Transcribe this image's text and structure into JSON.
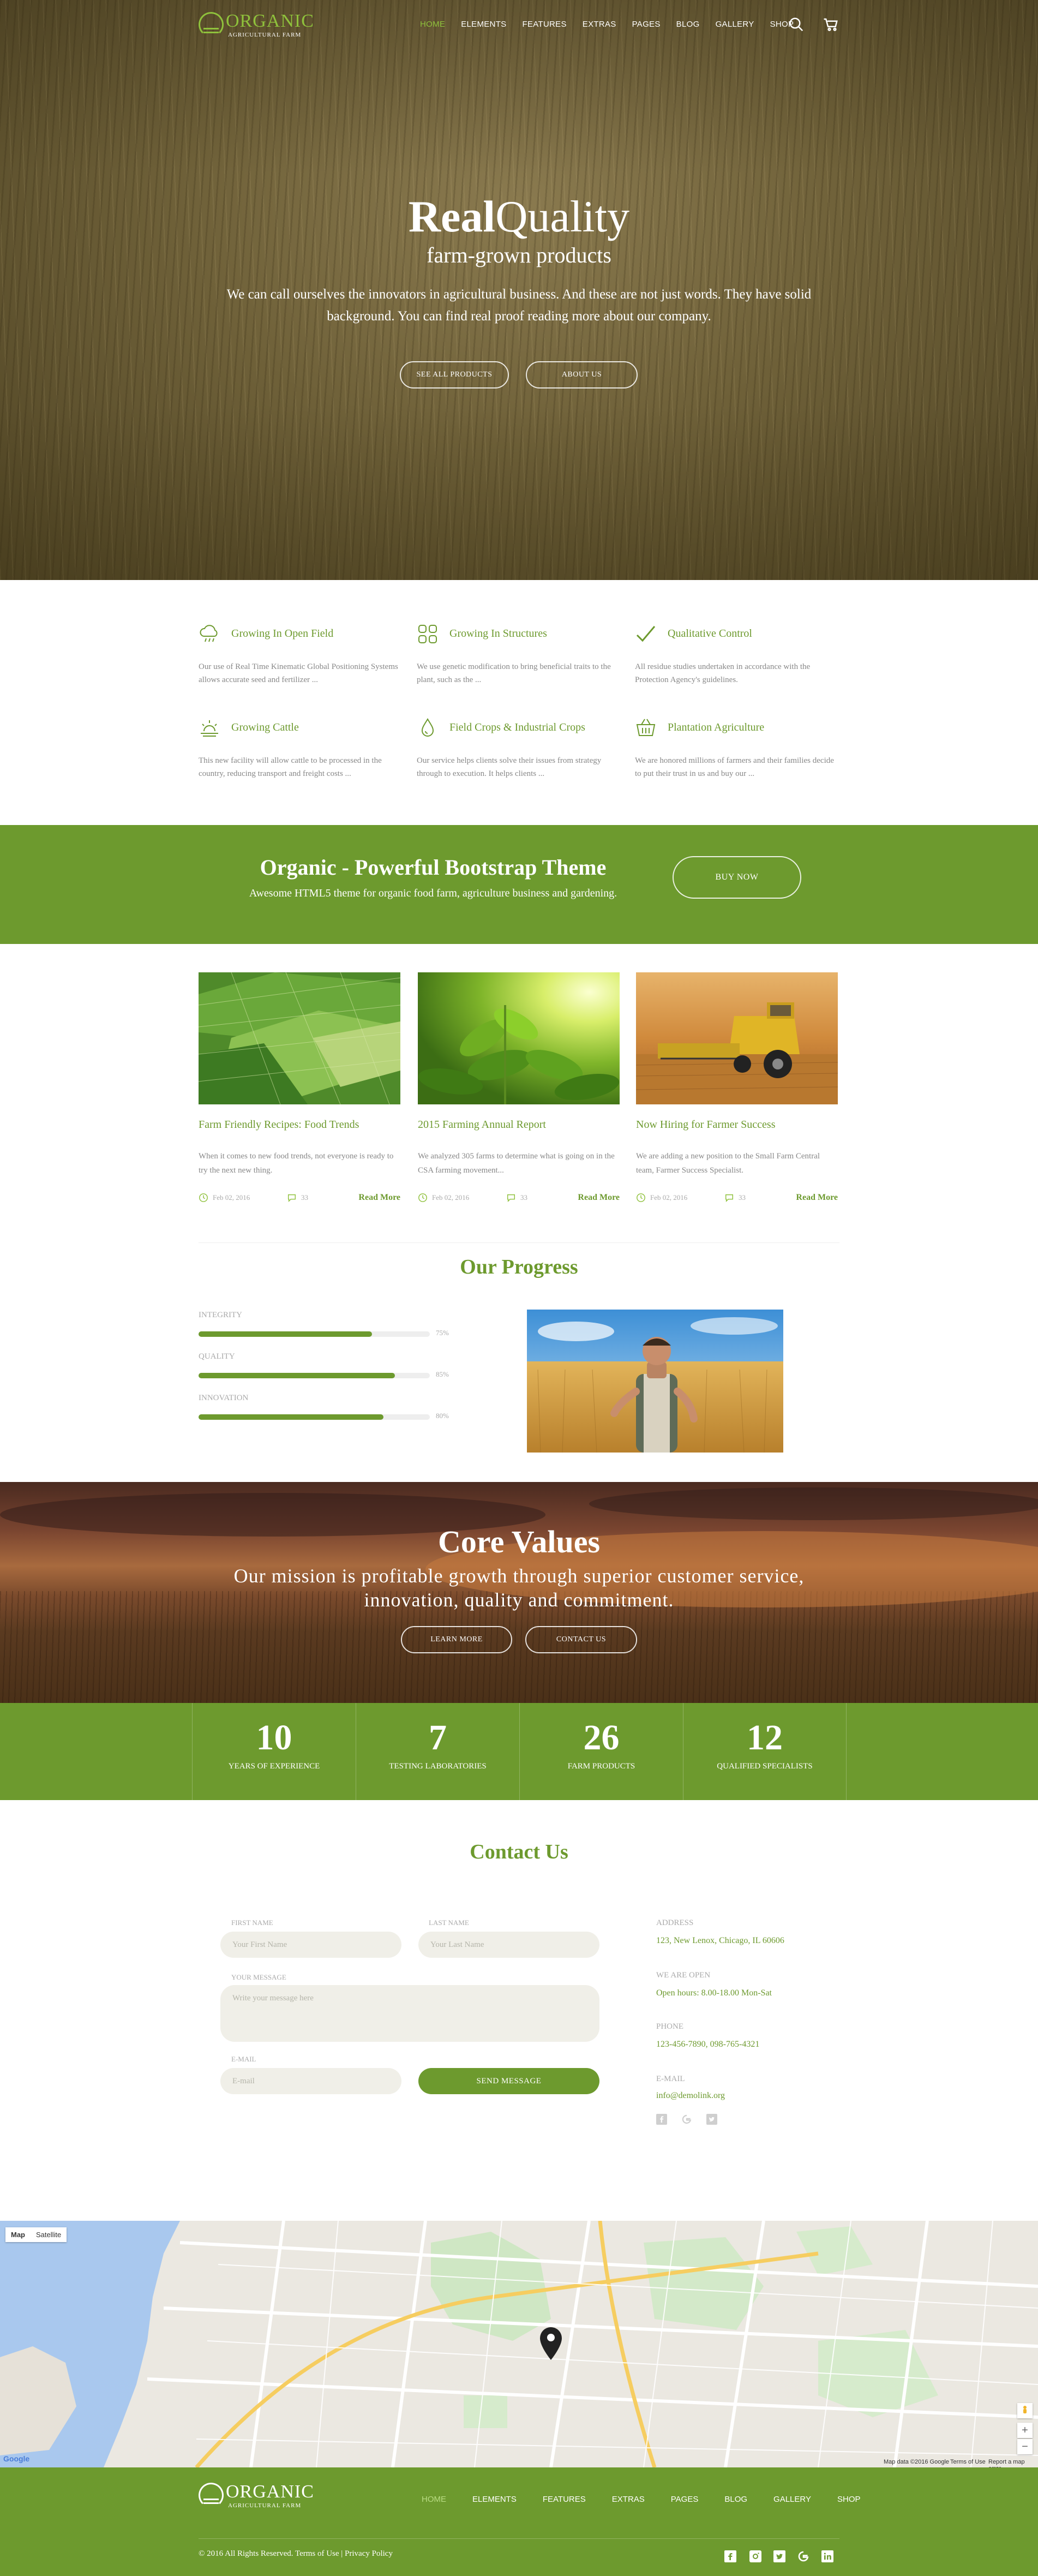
{
  "brand": {
    "name": "ORGANIC",
    "tagline": "Agricultural Farm"
  },
  "nav": [
    "HOME",
    "ELEMENTS",
    "FEATURES",
    "EXTRAS",
    "PAGES",
    "BLOG",
    "GALLERY",
    "SHOP"
  ],
  "hero": {
    "title_bold": "Real",
    "title_light": "Quality",
    "subtitle": "farm-grown products",
    "description": "We can call ourselves the innovators in agricultural business. And these are not just words. They have solid background. You can find real proof reading more about our company.",
    "btn_products": "SEE ALL PRODUCTS",
    "btn_about": "ABOUT US"
  },
  "features": [
    {
      "icon": "cloud-rain-icon",
      "title": "Growing In Open Field",
      "text": "Our use of Real Time Kinematic Global Positioning Systems allows accurate seed and fertilizer ..."
    },
    {
      "icon": "grid-icon",
      "title": "Growing In Structures",
      "text": "We use genetic modification to bring beneficial traits to the plant, such as the ..."
    },
    {
      "icon": "check-icon",
      "title": "Qualitative Control",
      "text": "All residue studies undertaken in accordance with the Protection Agency's guidelines."
    },
    {
      "icon": "sunrise-icon",
      "title": "Growing Cattle",
      "text": "This new facility will allow cattle to be processed in the country, reducing transport and freight costs ..."
    },
    {
      "icon": "drop-icon",
      "title": "Field Crops & Industrial Crops",
      "text": "Our service helps clients solve their issues from strategy through to execution. It helps clients ..."
    },
    {
      "icon": "basket-icon",
      "title": "Plantation Agriculture",
      "text": "We are honored millions of farmers and their families decide to put their trust in us and buy our ..."
    }
  ],
  "banner": {
    "title": "Organic - Powerful Bootstrap Theme",
    "subtitle": "Awesome HTML5 theme for organic food farm, agriculture business and gardening.",
    "button": "BUY NOW"
  },
  "posts": [
    {
      "title": "Farm Friendly Recipes: Food Trends",
      "text": "When it comes to new food trends, not everyone is ready to try the next new thing.",
      "date": "Feb 02, 2016",
      "comments": "33",
      "more": "Read More"
    },
    {
      "title": "2015 Farming Annual Report",
      "text": "We analyzed 305 farms to determine what is going on in the CSA farming movement...",
      "date": "Feb 02, 2016",
      "comments": "33",
      "more": "Read More"
    },
    {
      "title": "Now Hiring for Farmer Success",
      "text": "We are adding a new position to the Small Farm Central team, Farmer Success Specialist.",
      "date": "Feb 02, 2016",
      "comments": "33",
      "more": "Read More"
    }
  ],
  "progress": {
    "title": "Our Progress",
    "bars": [
      {
        "label": "INTEGRITY",
        "value": 75,
        "pct": "75%"
      },
      {
        "label": "QUALITY",
        "value": 85,
        "pct": "85%"
      },
      {
        "label": "INNOVATION",
        "value": 80,
        "pct": "80%"
      }
    ]
  },
  "core": {
    "title_bold": "Core",
    "title_light": "Values",
    "subtitle": "Our mission is profitable growth through superior customer service, innovation, quality and commitment.",
    "btn_learn": "LEARN MORE",
    "btn_contact": "CONTACT US"
  },
  "stats": [
    {
      "num": "10",
      "caption": "YEARS OF EXPERIENCE"
    },
    {
      "num": "7",
      "caption": "TESTING LABORATORIES"
    },
    {
      "num": "26",
      "caption": "FARM PRODUCTS"
    },
    {
      "num": "12",
      "caption": "QUALIFIED SPECIALISTS"
    }
  ],
  "contact": {
    "title": "Contact Us",
    "first_label": "FIRST NAME",
    "first_placeholder": "Your First Name",
    "last_label": "LAST NAME",
    "last_placeholder": "Your Last Name",
    "msg_label": "YOUR MESSAGE",
    "msg_placeholder": "Write your message here",
    "email_label": "E-MAIL",
    "email_placeholder": "E-mail",
    "send": "SEND MESSAGE",
    "address_label": "ADDRESS",
    "address": "123, New Lenox, Chicago, IL 60606",
    "open_label": "WE ARE OPEN",
    "open": "Open hours: 8.00-18.00 Mon-Sat",
    "phone_label": "PHONE",
    "phone": "123-456-7890, 098-765-4321",
    "email_info_label": "E-MAIL",
    "email": "info@demolink.org"
  },
  "map": {
    "tab_map": "Map",
    "tab_sat": "Satellite",
    "credit": "Map data ©2016 Google",
    "terms": "Terms of Use",
    "report": "Report a map error",
    "google": "Google",
    "zoom_in": "+",
    "zoom_out": "−"
  },
  "footer": {
    "nav": [
      "HOME",
      "ELEMENTS",
      "FEATURES",
      "EXTRAS",
      "PAGES",
      "BLOG",
      "GALLERY",
      "SHOP"
    ],
    "copyright": "© 2016 All Rights Reserved. Terms of Use | Privacy Policy"
  },
  "colors": {
    "accent": "#6d9a2e",
    "logo_green": "#8fc13c"
  }
}
